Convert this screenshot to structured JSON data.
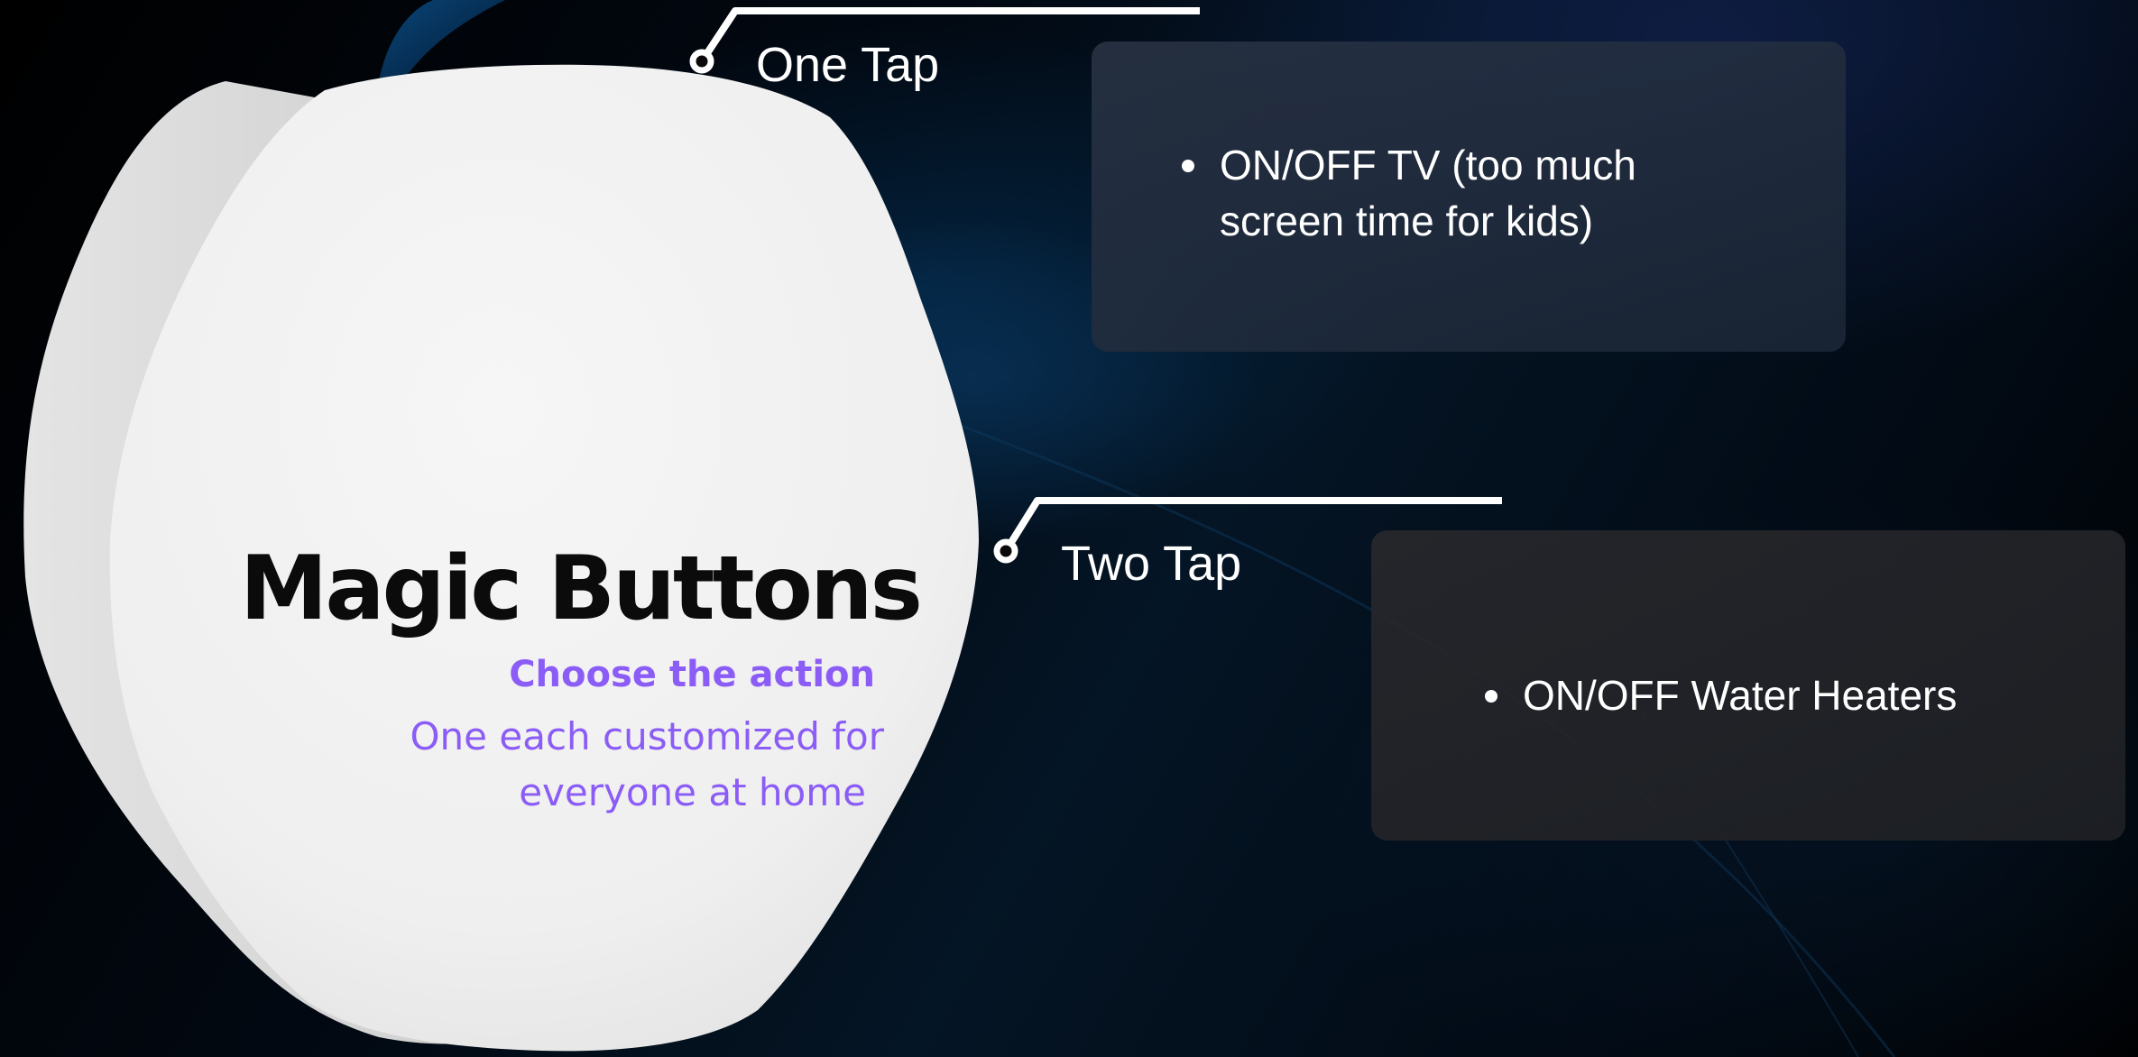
{
  "hero": {
    "title": "Magic Buttons",
    "subtitle": "Choose the action",
    "description_line1": "One each customized for",
    "description_line2": "everyone at home"
  },
  "callouts": [
    {
      "label": "One Tap",
      "items": [
        "ON/OFF TV (too much screen time for kids)"
      ]
    },
    {
      "label": "Two Tap",
      "items": [
        "ON/OFF Water Heaters"
      ]
    }
  ],
  "colors": {
    "accent_purple": "#8b5cf6",
    "title": "#0b0b0b",
    "device_white": "#f2f2f2",
    "background": "#000000",
    "text_white": "#ffffff"
  },
  "icons": {
    "bullet": "bullet-dot-icon",
    "connector": "callout-connector-icon"
  }
}
